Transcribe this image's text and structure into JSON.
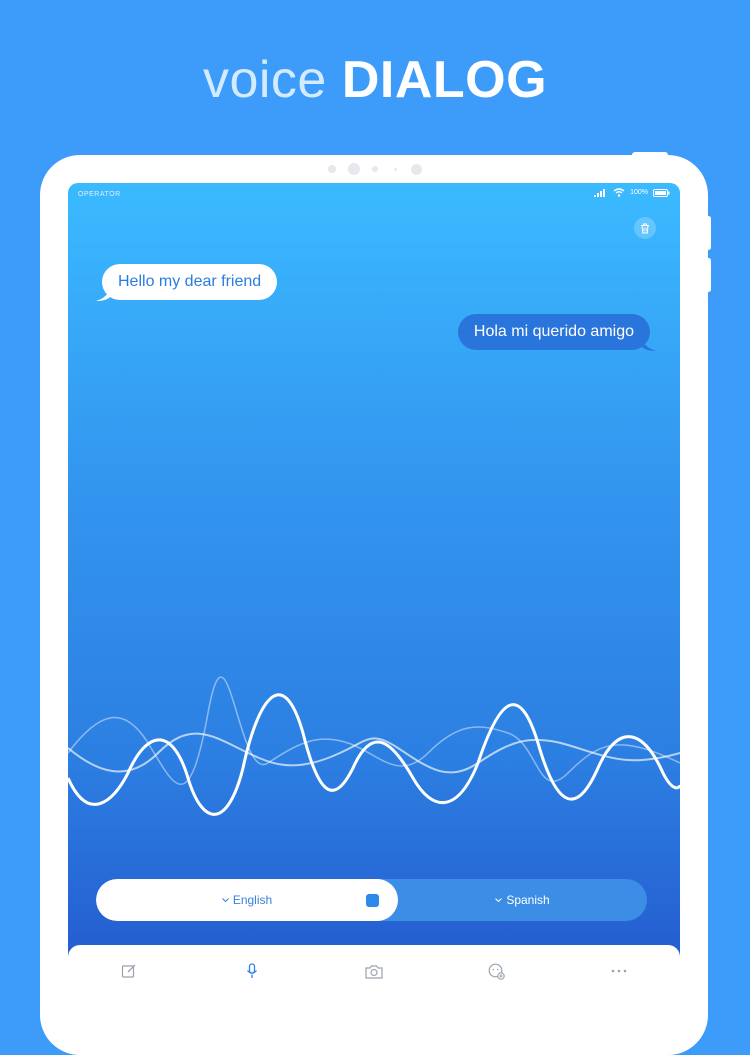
{
  "headline": {
    "light": "voice",
    "bold": "DIALOG"
  },
  "status_bar": {
    "carrier": "OPERATOR",
    "battery": "100%"
  },
  "conversation": {
    "messages": [
      {
        "text": "Hello my dear friend",
        "side": "left"
      },
      {
        "text": "Hola mi querido amigo",
        "side": "right"
      }
    ]
  },
  "language_bar": {
    "source": "English",
    "target": "Spanish"
  },
  "toolbar": {
    "items": [
      "edit-icon",
      "microphone-icon",
      "camera-icon",
      "phrasebook-icon",
      "more-icon"
    ]
  },
  "colors": {
    "background": "#3d9bfa",
    "screen_top": "#3bbaff",
    "screen_bottom": "#2355cc",
    "bubble_left_text": "#2a7de0",
    "bubble_right_bg": "#2a75db"
  }
}
